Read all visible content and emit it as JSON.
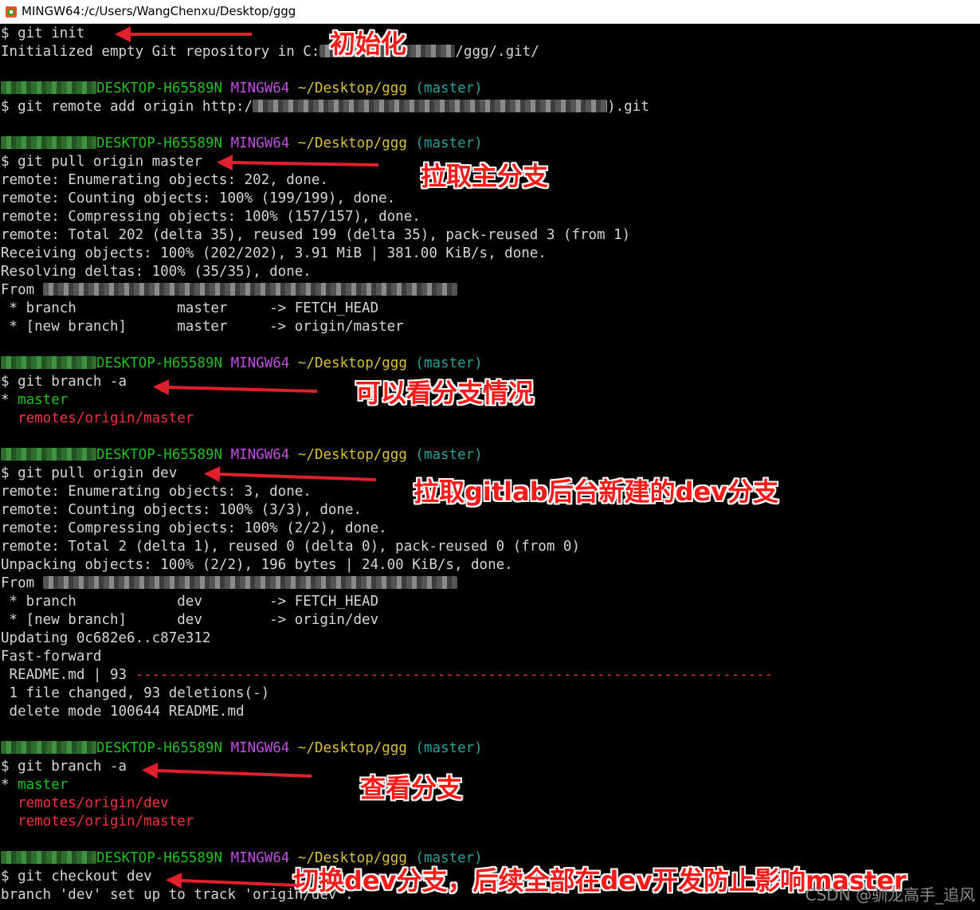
{
  "window": {
    "title": "MINGW64:/c/Users/WangChenxu/Desktop/ggg",
    "icon": "git-bash-icon"
  },
  "prompt": {
    "host": "DESKTOP-H65589N",
    "shell": "MINGW64",
    "path": "~/Desktop/ggg",
    "branch": "(master)"
  },
  "colors": {
    "host": "#1fc01f",
    "shell": "#c050e0",
    "path": "#d7c13c",
    "branch": "#2aa198",
    "remote_branch": "#ee3344",
    "annotation": "#ff1a1a"
  },
  "lines": [
    {
      "kind": "cmd",
      "text": "$ git init"
    },
    {
      "kind": "partial",
      "a": "Initialized empty Git repository in C:",
      "b": "/ggg/.git/",
      "blur": 170,
      "blur_color": "gray"
    },
    {
      "kind": "blank"
    },
    {
      "kind": "prompt",
      "blur": 120
    },
    {
      "kind": "partial",
      "a": "$ git remote add origin http:/",
      "b": ").git",
      "blur": 445,
      "blur_color": "gray"
    },
    {
      "kind": "blank"
    },
    {
      "kind": "prompt",
      "blur": 120
    },
    {
      "kind": "cmd",
      "text": "$ git pull origin master"
    },
    {
      "kind": "text",
      "text": "remote: Enumerating objects: 202, done."
    },
    {
      "kind": "text",
      "text": "remote: Counting objects: 100% (199/199), done."
    },
    {
      "kind": "text",
      "text": "remote: Compressing objects: 100% (157/157), done."
    },
    {
      "kind": "text",
      "text": "remote: Total 202 (delta 35), reused 199 (delta 35), pack-reused 3 (from 1)"
    },
    {
      "kind": "text",
      "text": "Receiving objects: 100% (202/202), 3.91 MiB | 381.00 KiB/s, done."
    },
    {
      "kind": "text",
      "text": "Resolving deltas: 100% (35/35), done."
    },
    {
      "kind": "partial",
      "a": "From ",
      "b": "",
      "blur": 520,
      "blur_color": "gray"
    },
    {
      "kind": "text",
      "text": " * branch            master     -> FETCH_HEAD"
    },
    {
      "kind": "text",
      "text": " * [new branch]      master     -> origin/master"
    },
    {
      "kind": "blank"
    },
    {
      "kind": "prompt",
      "blur": 120
    },
    {
      "kind": "cmd",
      "text": "$ git branch -a"
    },
    {
      "kind": "current_branch",
      "star": "* ",
      "name": "master"
    },
    {
      "kind": "remote_branch",
      "text": "  remotes/origin/master"
    },
    {
      "kind": "blank"
    },
    {
      "kind": "prompt",
      "blur": 120
    },
    {
      "kind": "cmd",
      "text": "$ git pull origin dev"
    },
    {
      "kind": "text",
      "text": "remote: Enumerating objects: 3, done."
    },
    {
      "kind": "text",
      "text": "remote: Counting objects: 100% (3/3), done."
    },
    {
      "kind": "text",
      "text": "remote: Compressing objects: 100% (2/2), done."
    },
    {
      "kind": "text",
      "text": "remote: Total 2 (delta 1), reused 0 (delta 0), pack-reused 0 (from 0)"
    },
    {
      "kind": "text",
      "text": "Unpacking objects: 100% (2/2), 196 bytes | 24.00 KiB/s, done."
    },
    {
      "kind": "partial",
      "a": "From ",
      "b": "",
      "blur": 520,
      "blur_color": "gray"
    },
    {
      "kind": "text",
      "text": " * branch            dev        -> FETCH_HEAD"
    },
    {
      "kind": "text",
      "text": " * [new branch]      dev        -> origin/dev"
    },
    {
      "kind": "text",
      "text": "Updating 0c682e6..c87e312"
    },
    {
      "kind": "text",
      "text": "Fast-forward"
    },
    {
      "kind": "diffstat",
      "text": " README.md | 93 ",
      "bar": "----------------------------------------------------------------------------"
    },
    {
      "kind": "text",
      "text": " 1 file changed, 93 deletions(-)"
    },
    {
      "kind": "text",
      "text": " delete mode 100644 README.md"
    },
    {
      "kind": "blank"
    },
    {
      "kind": "prompt",
      "blur": 120
    },
    {
      "kind": "cmd",
      "text": "$ git branch -a"
    },
    {
      "kind": "current_branch",
      "star": "* ",
      "name": "master"
    },
    {
      "kind": "remote_branch",
      "text": "  remotes/origin/dev"
    },
    {
      "kind": "remote_branch",
      "text": "  remotes/origin/master"
    },
    {
      "kind": "blank"
    },
    {
      "kind": "prompt",
      "blur": 120
    },
    {
      "kind": "cmd",
      "text": "$ git checkout dev"
    },
    {
      "kind": "text",
      "text": "branch 'dev' set up to track 'origin/dev'."
    }
  ],
  "annotations": [
    {
      "text": "初始化"
    },
    {
      "text": "拉取主分支"
    },
    {
      "text": "可以看分支情况"
    },
    {
      "text": "拉取gitlab后台新建的dev分支"
    },
    {
      "text": "查看分支"
    },
    {
      "text": "切换dev分支，后续全部在dev开发防止影响master"
    }
  ],
  "watermark": "CSDN @驯龙高手_追风"
}
